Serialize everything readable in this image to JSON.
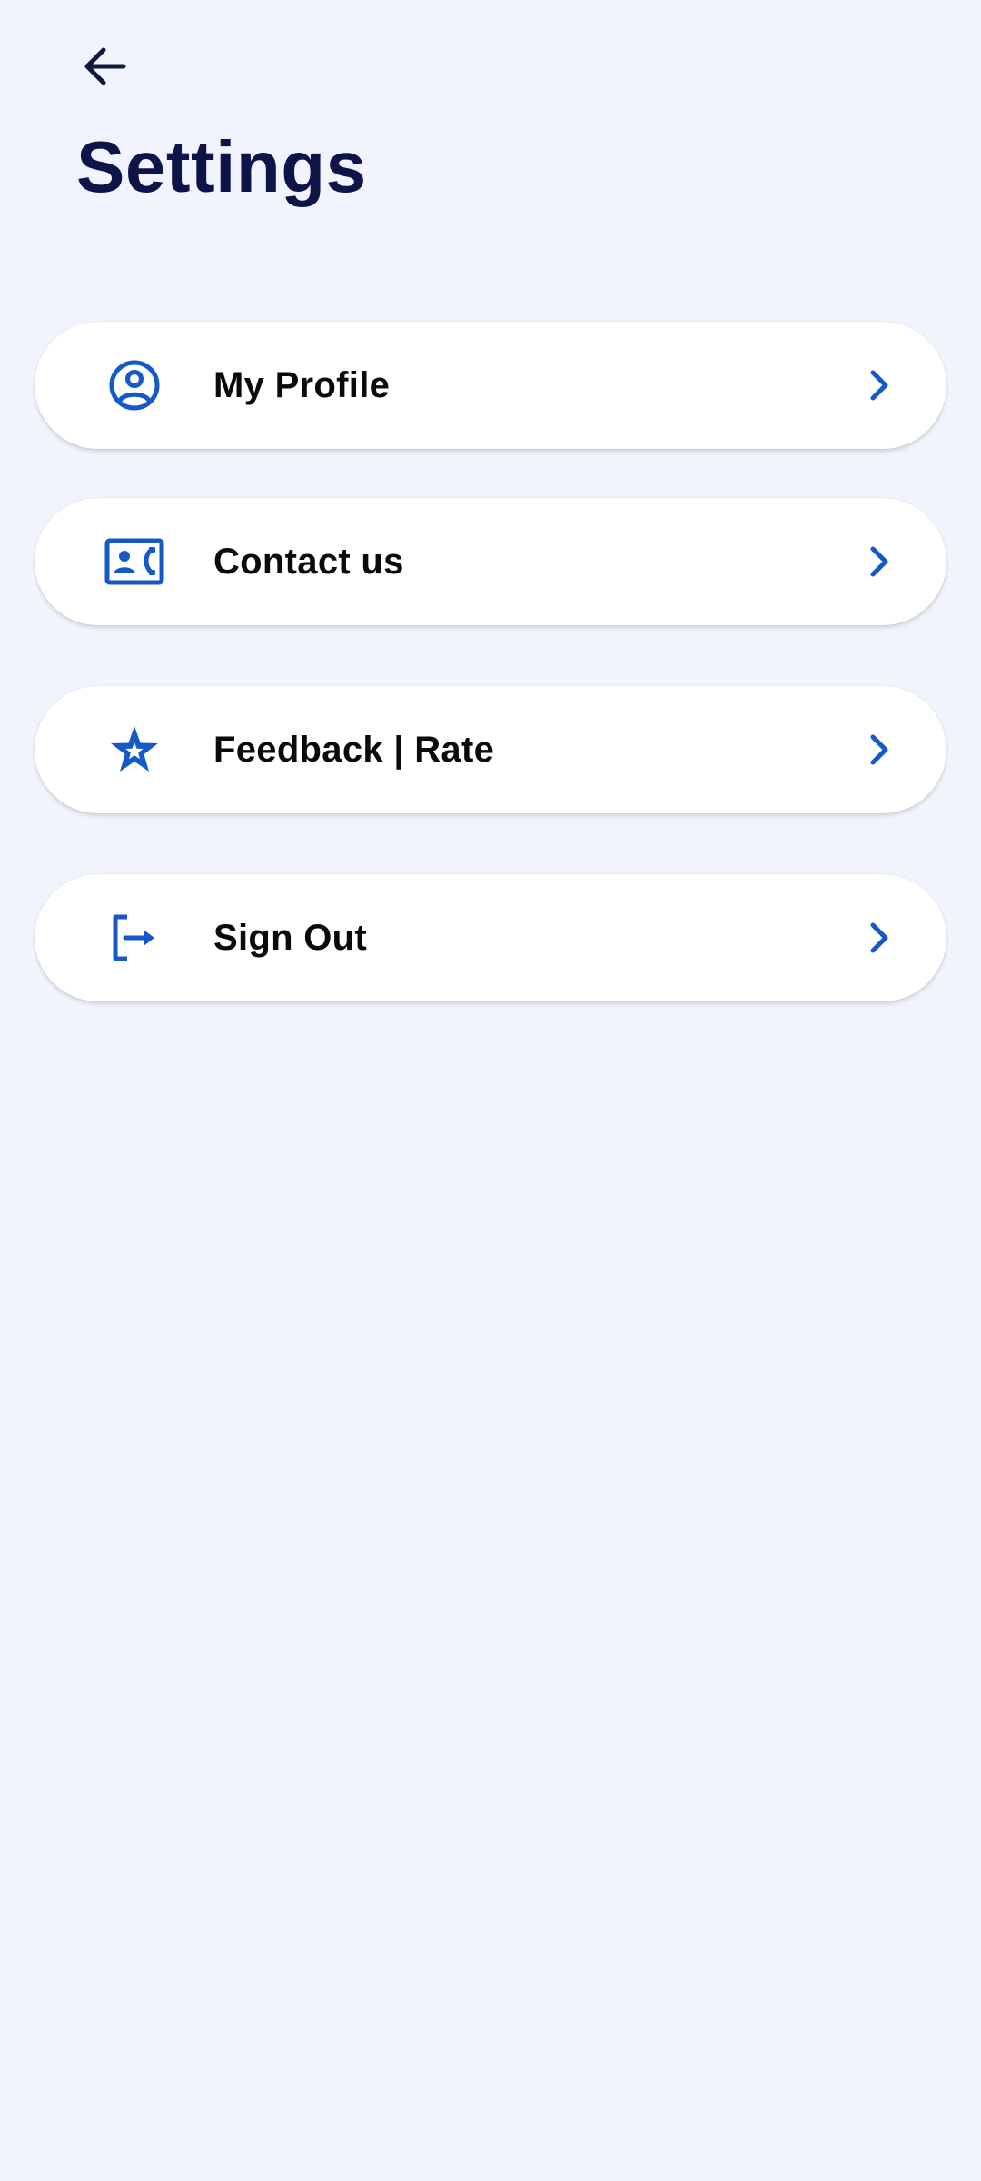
{
  "header": {
    "title": "Settings",
    "back_icon": "arrow-left-icon"
  },
  "colors": {
    "background": "#f1f4fc",
    "title": "#0d1448",
    "accent": "#1558c7",
    "card": "#ffffff",
    "label": "#0a0a0a"
  },
  "menu": {
    "items": [
      {
        "label": "My Profile",
        "icon": "user-circle-icon"
      },
      {
        "label": "Contact us",
        "icon": "contact-card-icon"
      },
      {
        "label": "Feedback | Rate",
        "icon": "star-icon"
      },
      {
        "label": "Sign Out",
        "icon": "sign-out-icon"
      }
    ]
  }
}
